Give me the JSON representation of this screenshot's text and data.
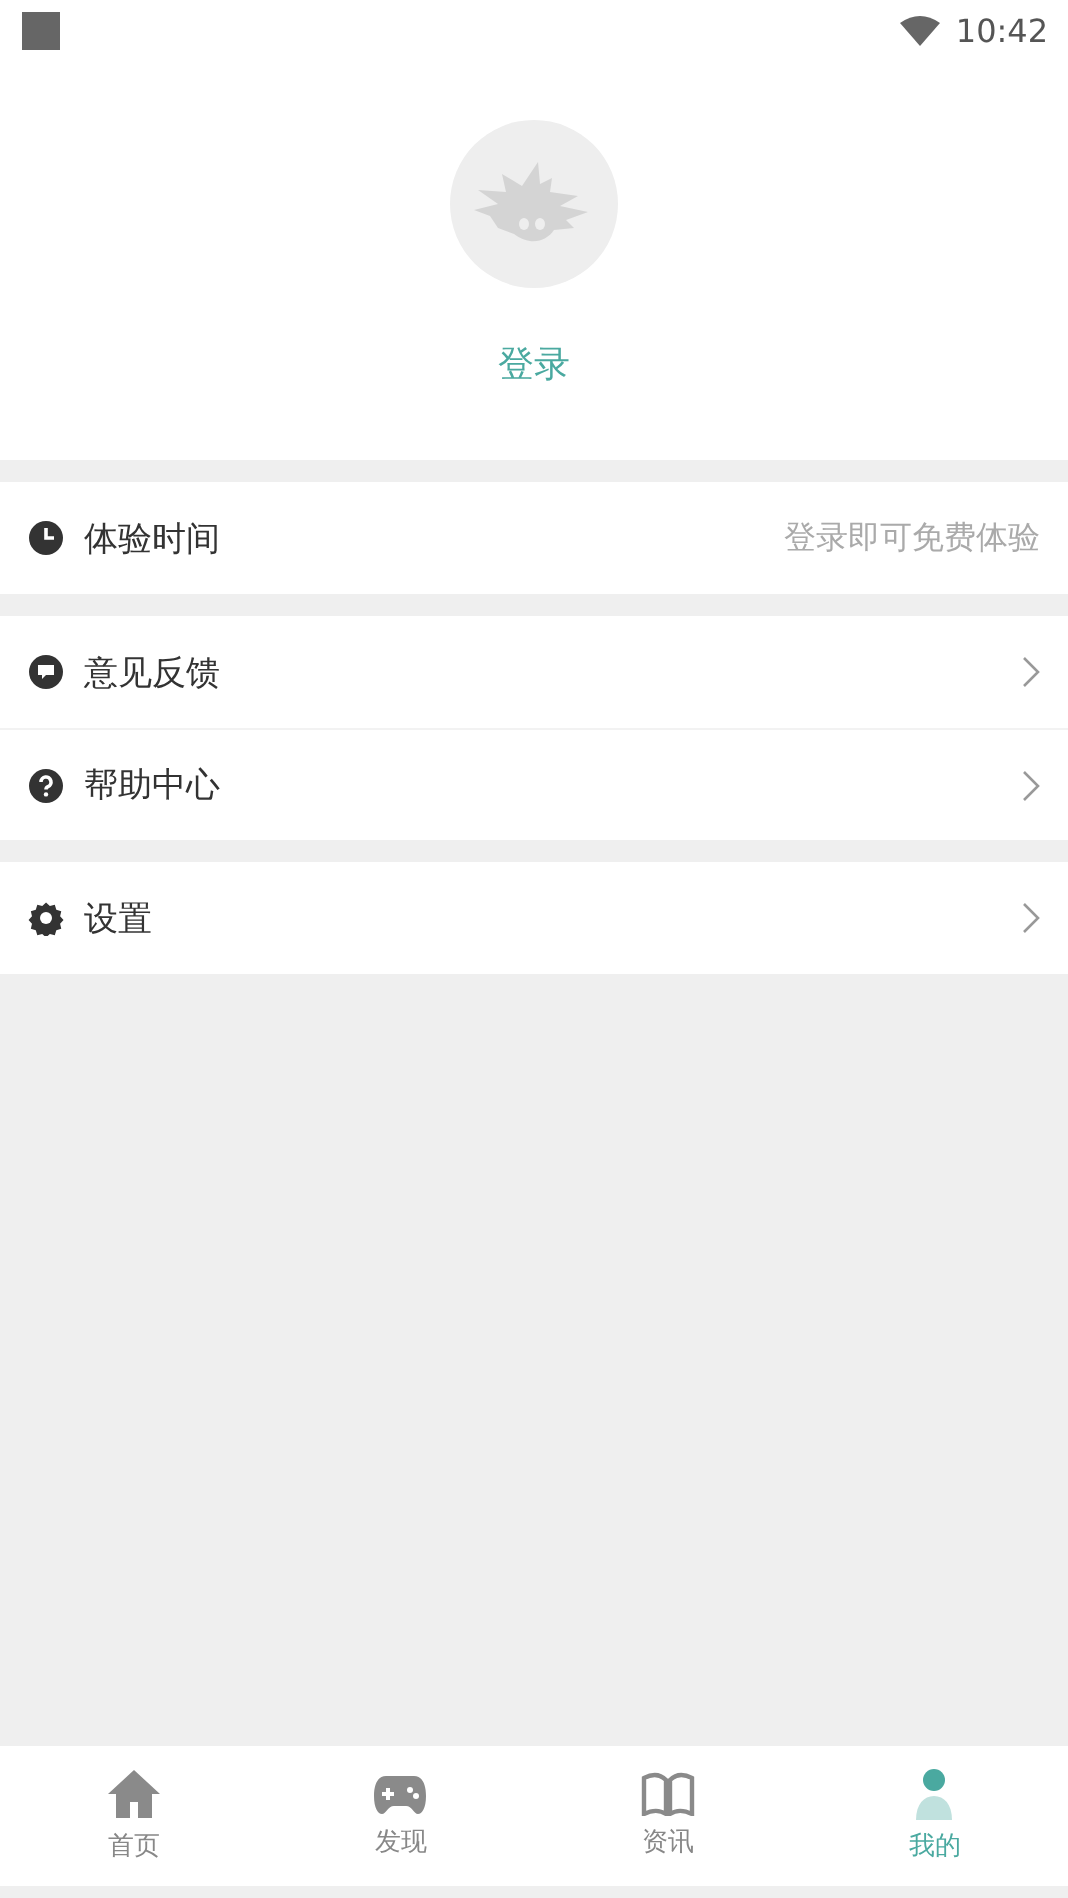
{
  "status_bar": {
    "time": "10:42"
  },
  "profile": {
    "login": "登录"
  },
  "groups": [
    {
      "items": [
        {
          "kind": "value",
          "label": "体验时间",
          "value": "登录即可免费体验"
        }
      ]
    },
    {
      "items": [
        {
          "kind": "link",
          "label": "意见反馈"
        },
        {
          "kind": "link",
          "label": "帮助中心"
        }
      ]
    },
    {
      "items": [
        {
          "kind": "link",
          "label": "设置"
        }
      ]
    }
  ],
  "tabs": [
    {
      "label": "首页",
      "selected": false
    },
    {
      "label": "发现",
      "selected": false
    },
    {
      "label": "资讯",
      "selected": false
    },
    {
      "label": "我的",
      "selected": true
    }
  ]
}
